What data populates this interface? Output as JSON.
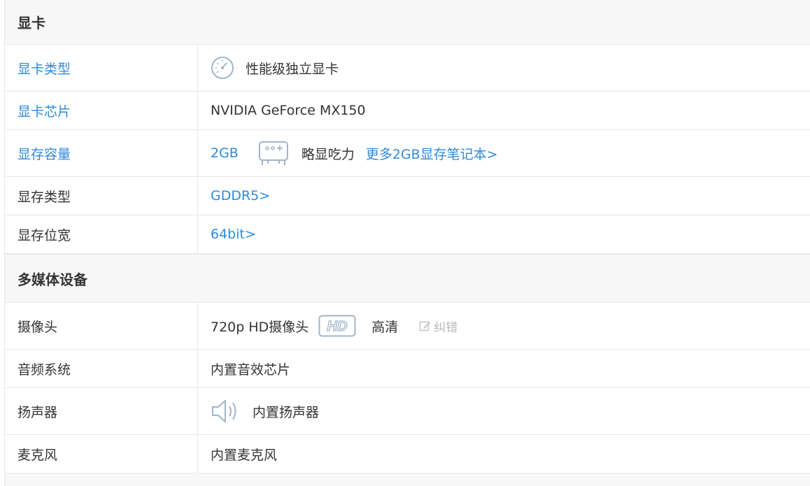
{
  "gpu_section": {
    "title": "显卡",
    "rows": [
      {
        "label": "显卡类型",
        "value": "性能级独立显卡"
      },
      {
        "label": "显卡芯片",
        "value": "NVIDIA GeForce MX150"
      },
      {
        "label": "显存容量",
        "value": "2GB",
        "note": "略显吃力",
        "link": "更多2GB显存笔记本>"
      },
      {
        "label": "显存类型",
        "value": "GDDR5>"
      },
      {
        "label": "显存位宽",
        "value": "64bit>"
      }
    ]
  },
  "multimedia_section": {
    "title": "多媒体设备",
    "rows": [
      {
        "label": "摄像头",
        "value": "720p HD摄像头",
        "badge": "HD",
        "quality": "高清",
        "correction": "纠错"
      },
      {
        "label": "音频系统",
        "value": "内置音效芯片"
      },
      {
        "label": "扬声器",
        "value": "内置扬声器"
      },
      {
        "label": "麦克风",
        "value": "内置麦克风"
      }
    ]
  },
  "icons": {
    "gpu_type": "speedometer-icon",
    "vram_capacity": "gamepad-icon",
    "camera_badge": "hd-badge-icon",
    "correction": "edit-icon",
    "speaker": "speaker-icon"
  },
  "colors": {
    "link": "#2f8ad8",
    "text": "#333333",
    "icon": "#9fb6c8",
    "muted": "#b7b7b7",
    "header_bg": "#f7f7f7",
    "border": "#e8e8e8"
  }
}
